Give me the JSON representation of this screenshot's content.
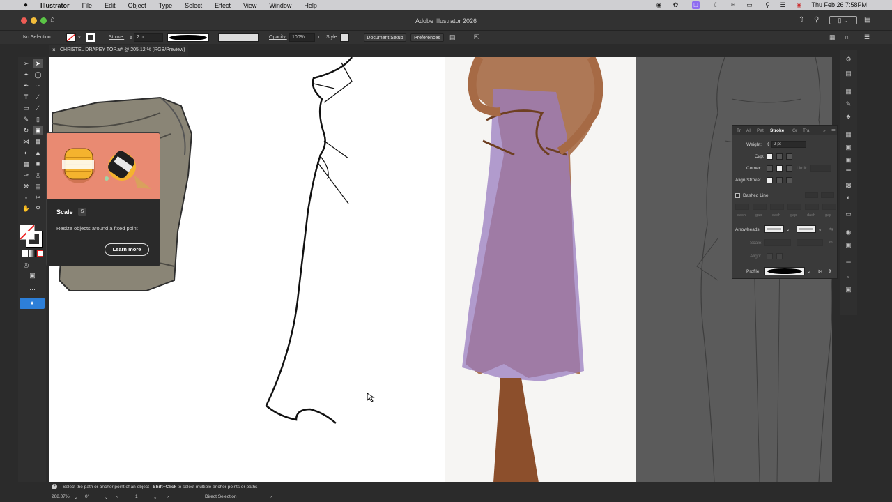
{
  "menubar": {
    "apple": "",
    "app": "Illustrator",
    "items": [
      "File",
      "Edit",
      "Object",
      "Type",
      "Select",
      "Effect",
      "View",
      "Window",
      "Help"
    ],
    "clock": "Thu Feb 26  7:58PM"
  },
  "window": {
    "title": "Adobe Illustrator 2026"
  },
  "controlbar": {
    "selection": "No Selection",
    "stroke_label": "Stroke:",
    "stroke_value": "2 pt",
    "opacity_label": "Opacity:",
    "opacity_value": "100%",
    "style_label": "Style:",
    "document_setup": "Document Setup",
    "preferences": "Preferences"
  },
  "document": {
    "tab_title": "CHRISTEL DRAPEY TOP.ai* @ 205.12 % (RGB/Preview)"
  },
  "tooltip": {
    "tool_name": "Scale",
    "shortcut": "S",
    "description": "Resize objects around a fixed point",
    "learn_more": "Learn more"
  },
  "stroke_panel": {
    "tabs": [
      "Tr",
      "Ali",
      "Pat",
      "Stroke",
      "Gr",
      "Tra"
    ],
    "active_tab": "Stroke",
    "weight_label": "Weight:",
    "weight_value": "2 pt",
    "cap_label": "Cap:",
    "corner_label": "Corner:",
    "limit_label": "Limit:",
    "align_label": "Align Stroke:",
    "dashed_label": "Dashed Line",
    "dash_labels": [
      "dash",
      "gap",
      "dash",
      "gap",
      "dash",
      "gap"
    ],
    "arrowheads_label": "Arrowheads:",
    "scale_label": "Scale:",
    "align2_label": "Align:",
    "profile_label": "Profile:"
  },
  "statusbar": {
    "hint_main": "Select the path or anchor point of an object",
    "hint_sep": "|",
    "hint_shift": "Shift+Click",
    "hint_rest": "to select multiple anchor points or paths",
    "zoom": "268.07%",
    "rotation": "0°",
    "artboard": "1",
    "tool": "Direct Selection"
  },
  "colors": {
    "ui_dark": "#323232",
    "artboard": "#ffffff",
    "pasteboard": "#5b5b5b",
    "tooltip_hero": "#e98a72",
    "dress_purple": "#9a7cc0",
    "skin": "#a66a45"
  }
}
